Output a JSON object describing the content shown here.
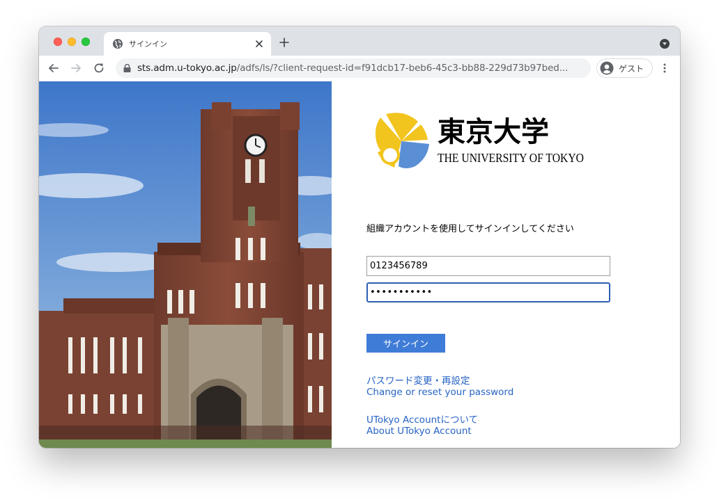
{
  "browser": {
    "tab_title": "サインイン",
    "url_host": "sts.adm.u-tokyo.ac.jp",
    "url_path": "/adfs/ls/?client-request-id=f91dcb17-beb6-45c3-bb88-229d73b97bed...",
    "profile_label": "ゲスト",
    "icons": [
      "globe-icon",
      "close-icon",
      "plus-icon",
      "tab-search-icon",
      "back-icon",
      "forward-icon",
      "reload-icon",
      "lock-icon",
      "avatar-icon",
      "kebab-menu-icon"
    ]
  },
  "logo": {
    "kanji": "東京大学",
    "english": "THE UNIVERSITY OF TOKYO",
    "colors": {
      "ginkgo_yellow": "#f2c41e",
      "ginkgo_blue": "#5a8fd6"
    }
  },
  "form": {
    "prompt": "組織アカウントを使用してサインインしてください",
    "username_value": "0123456789",
    "password_value": "•••••••••••",
    "submit_label": "サインイン"
  },
  "links": {
    "password_ja": "パスワード変更・再設定",
    "password_en": "Change or reset your password",
    "about_ja": "UTokyo Accountについて",
    "about_en": "About UTokyo Account"
  },
  "colors": {
    "link": "#2663c4",
    "button": "#3f7cd7",
    "focus_border": "#2b5fb3"
  }
}
